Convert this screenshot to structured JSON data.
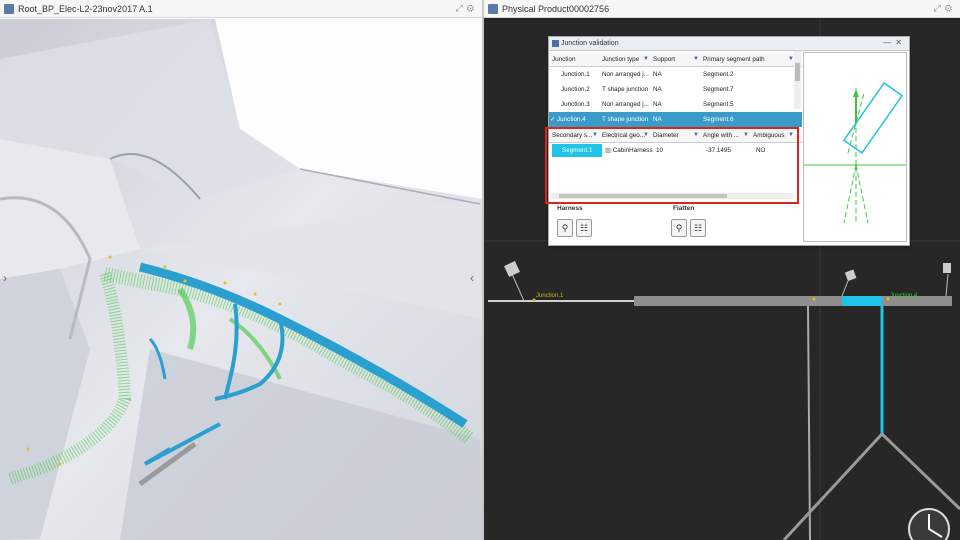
{
  "left_window": {
    "title": "Root_BP_Elec-L2-23nov2017 A.1"
  },
  "right_window": {
    "title": "Physical Product00002756"
  },
  "dialog": {
    "title": "Junction validation",
    "junction_headers": [
      "Junction",
      "Junction type",
      "Support",
      "Primary segment path"
    ],
    "junction_rows": [
      {
        "junction": "Junction.1",
        "type": "Non arranged j...",
        "support": "NA",
        "segment": "Segment.2"
      },
      {
        "junction": "Junction.2",
        "type": "T shape junction",
        "support": "NA",
        "segment": "Segment.7"
      },
      {
        "junction": "Junction.3",
        "type": "Non arranged j...",
        "support": "NA",
        "segment": "Segment.5"
      },
      {
        "junction": "Junction.4",
        "type": "T shape junction",
        "support": "NA",
        "segment": "Segment.6"
      }
    ],
    "selected_row_check": "✓",
    "secondary_headers": [
      "Secondary s...",
      "Electrical geo...",
      "Diameter",
      "Angle with ...",
      "Ambiguous"
    ],
    "secondary_rows": [
      {
        "segment": "Segment.1",
        "geo": "CabinHarness",
        "diameter": "10",
        "angle": "-37.1495",
        "ambiguous": "NO"
      }
    ],
    "harness_label": "Harness",
    "flatten_label": "Flatten"
  },
  "viewport_labels": {
    "junction_left": "Junction.1",
    "junction_right": "Junction.4"
  },
  "colors": {
    "accent": "#3a9bc8",
    "highlight": "#d9261c",
    "segment_cyan": "#1fc4e6",
    "harness_green": "#3cc83c",
    "harness_blue": "#2a9fd0"
  }
}
